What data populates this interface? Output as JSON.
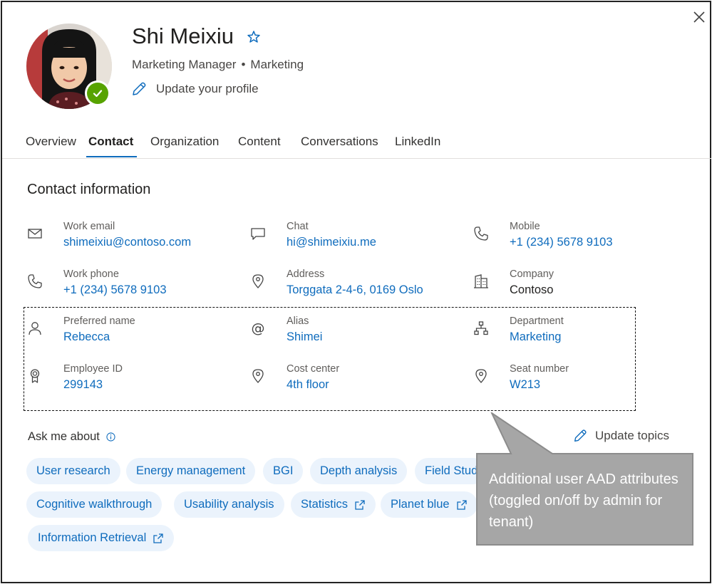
{
  "profile": {
    "name": "Shi Meixiu",
    "job_title": "Marketing Manager",
    "separator": "•",
    "department": "Marketing",
    "update_profile_label": "Update your profile",
    "presence_color": "#57a300"
  },
  "tabs": [
    {
      "label": "Overview"
    },
    {
      "label": "Contact"
    },
    {
      "label": "Organization"
    },
    {
      "label": "Content"
    },
    {
      "label": "Conversations"
    },
    {
      "label": "LinkedIn"
    }
  ],
  "active_tab": "Contact",
  "contact": {
    "title": "Contact information",
    "fields": [
      {
        "icon": "mail-icon",
        "label": "Work email",
        "value": "shimeixiu@contoso.com"
      },
      {
        "icon": "chat-icon",
        "label": "Chat",
        "value": "hi@shimeixiu.me"
      },
      {
        "icon": "phone-icon",
        "label": "Mobile",
        "value": "+1 (234) 5678 9103"
      },
      {
        "icon": "phone-icon",
        "label": "Work phone",
        "value": "+1 (234) 5678 9103"
      },
      {
        "icon": "location-icon",
        "label": "Address",
        "value": "Torggata 2-4-6, 0169 Oslo"
      },
      {
        "icon": "building-icon",
        "label": "Company",
        "value": "Contoso"
      },
      {
        "icon": "person-icon",
        "label": "Preferred name",
        "value": "Rebecca"
      },
      {
        "icon": "at-icon",
        "label": "Alias",
        "value": "Shimei"
      },
      {
        "icon": "org-chart-icon",
        "label": "Department",
        "value": "Marketing"
      },
      {
        "icon": "badge-icon",
        "label": "Employee ID",
        "value": "299143"
      },
      {
        "icon": "location-icon",
        "label": "Cost center",
        "value": "4th floor"
      },
      {
        "icon": "location-icon",
        "label": "Seat number",
        "value": "W213"
      }
    ]
  },
  "topics": {
    "title": "Ask me about",
    "update_label": "Update topics",
    "items": [
      {
        "label": "User research"
      },
      {
        "label": "Energy management"
      },
      {
        "label": "BGI"
      },
      {
        "label": "Depth analysis"
      },
      {
        "label": "Field Stud"
      },
      {
        "label": "Cognitive walkthrough"
      },
      {
        "label": "Usability analysis"
      },
      {
        "label": "Statistics",
        "external": true
      },
      {
        "label": "Planet blue",
        "external": true
      },
      {
        "label": "Information Retrieval",
        "external": true
      }
    ]
  },
  "callout": {
    "text": "Additional user AAD attributes (toggled on/off by admin for tenant)",
    "color": "#a6a6a6"
  },
  "colors": {
    "accent": "#0f6cbd",
    "pill_bg": "#ebf3fc"
  }
}
